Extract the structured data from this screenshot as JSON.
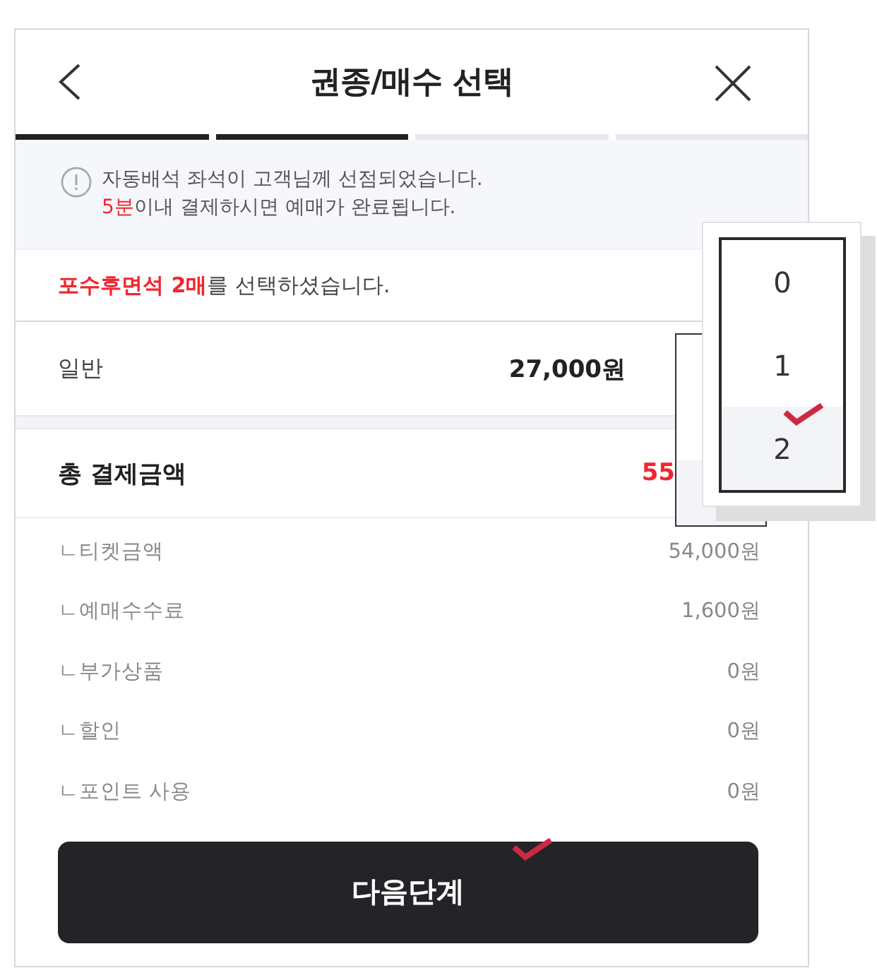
{
  "header": {
    "title": "권종/매수 선택"
  },
  "progress": {
    "steps": [
      {
        "completed": true
      },
      {
        "completed": true
      },
      {
        "completed": false
      },
      {
        "completed": false
      }
    ]
  },
  "notice": {
    "lines": [
      {
        "segments": [
          {
            "text": "자동배석 좌석이 고객님께 선점되었습니다.",
            "highlight": false
          }
        ]
      },
      {
        "segments": [
          {
            "text": "5분",
            "highlight": true
          },
          {
            "text": "이내 결제하시면 예매가 완료됩니다.",
            "highlight": false
          }
        ]
      }
    ]
  },
  "selection_summary": {
    "segments": [
      {
        "text": "포수후면석 2매",
        "highlight": true
      },
      {
        "text": "를 선택하셨습니다.",
        "highlight": false
      }
    ]
  },
  "ticket_types": [
    {
      "label": "일반",
      "price": "27,000원",
      "quantity_select": {
        "expanded": true,
        "options": [
          {
            "label": "0",
            "selected": false
          },
          {
            "label": "1",
            "selected": false
          },
          {
            "label": "2",
            "selected": true
          }
        ]
      }
    }
  ],
  "total": {
    "label": "총 결제금액",
    "amount": "55"
  },
  "breakdown": [
    {
      "label": "ㄴ티켓금액",
      "value": "54,000원"
    },
    {
      "label": "ㄴ예매수수료",
      "value": "1,600원"
    },
    {
      "label": "ㄴ부가상품",
      "value": "0원"
    },
    {
      "label": "ㄴ할인",
      "value": "0원"
    },
    {
      "label": "ㄴ포인트 사용",
      "value": "0원"
    }
  ],
  "next_button": {
    "label": "다음단계"
  }
}
